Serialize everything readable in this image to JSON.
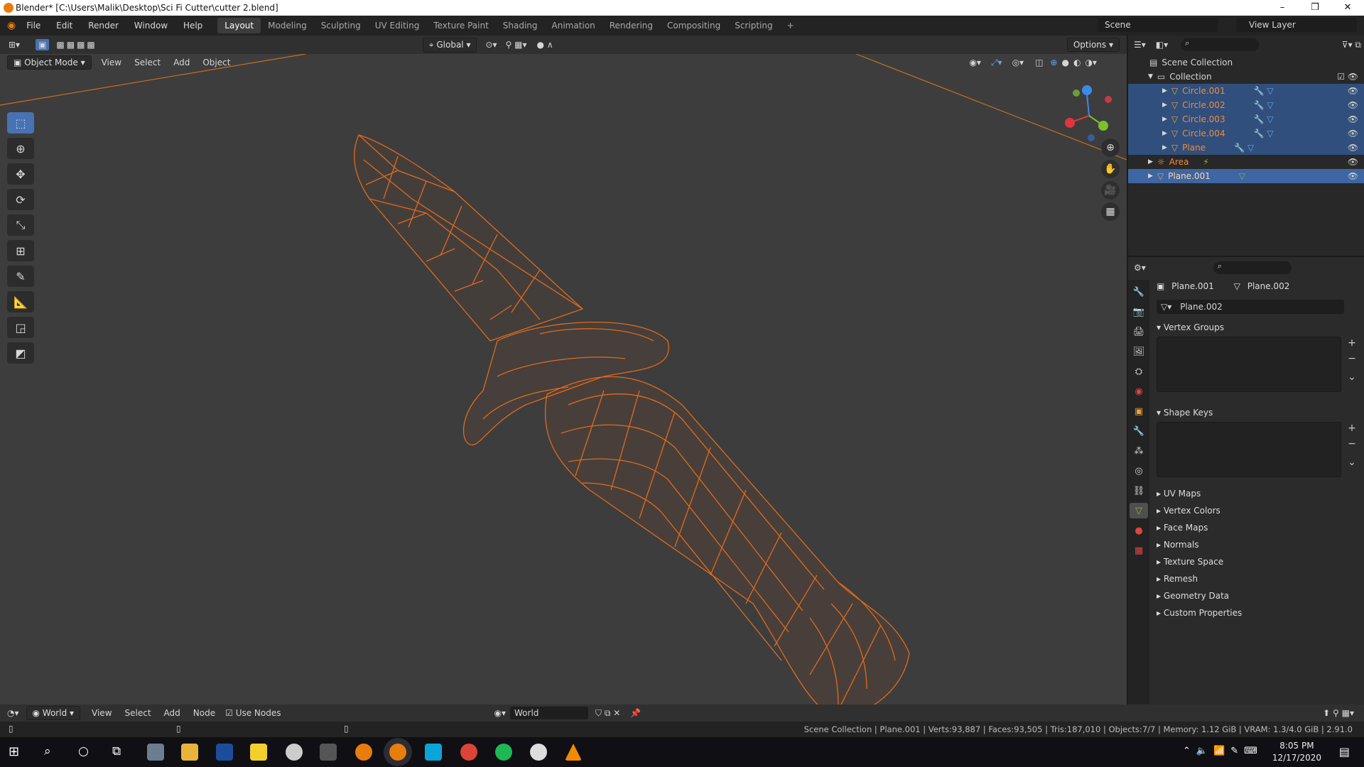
{
  "window": {
    "title": "Blender* [C:\\Users\\Malik\\Desktop\\Sci Fi Cutter\\cutter 2.blend]",
    "min": "–",
    "max": "❐",
    "close": "✕"
  },
  "menu": [
    "File",
    "Edit",
    "Render",
    "Window",
    "Help"
  ],
  "workspaces": [
    "Layout",
    "Modeling",
    "Sculpting",
    "UV Editing",
    "Texture Paint",
    "Shading",
    "Animation",
    "Rendering",
    "Compositing",
    "Scripting"
  ],
  "add_workspace": "+",
  "scene": "Scene",
  "view_layer": "View Layer",
  "header": {
    "transform_orientation": "Global",
    "options": "Options"
  },
  "viewport_header": {
    "mode": "Object Mode",
    "menus": [
      "View",
      "Select",
      "Add",
      "Object"
    ]
  },
  "outliner": {
    "root": "Scene Collection",
    "collection": "Collection",
    "items": [
      {
        "name": "Circle.001",
        "selected": true
      },
      {
        "name": "Circle.002",
        "selected": true
      },
      {
        "name": "Circle.003",
        "selected": true
      },
      {
        "name": "Circle.004",
        "selected": true
      },
      {
        "name": "Plane",
        "selected": true
      },
      {
        "name": "Area",
        "selected": false
      },
      {
        "name": "Plane.001",
        "selected": true
      }
    ]
  },
  "properties": {
    "object": "Plane.001",
    "mesh": "Plane.002",
    "datablock": "Plane.002",
    "open_panels": [
      "Vertex Groups",
      "Shape Keys"
    ],
    "closed_panels": [
      "UV Maps",
      "Vertex Colors",
      "Face Maps",
      "Normals",
      "Texture Space",
      "Remesh",
      "Geometry Data",
      "Custom Properties"
    ]
  },
  "shader_editor": {
    "world_type": "World",
    "menus": [
      "View",
      "Select",
      "Add",
      "Node"
    ],
    "use_nodes_label": "Use Nodes",
    "use_nodes": true,
    "world_name": "World"
  },
  "status": "Scene Collection | Plane.001 | Verts:93,887 | Faces:93,505 | Tris:187,010 | Objects:7/7 | Memory: 1.12 GiB | VRAM: 1.3/4.0 GiB | 2.91.0",
  "clock": {
    "time": "8:05 PM",
    "date": "12/17/2020"
  },
  "colors": {
    "accent": "#4772b3",
    "wire": "#e06a1e",
    "selected_text": "#f08a3c",
    "axis_x": "#e0353f",
    "axis_y": "#7ac22c",
    "axis_z": "#3b8ae8"
  }
}
